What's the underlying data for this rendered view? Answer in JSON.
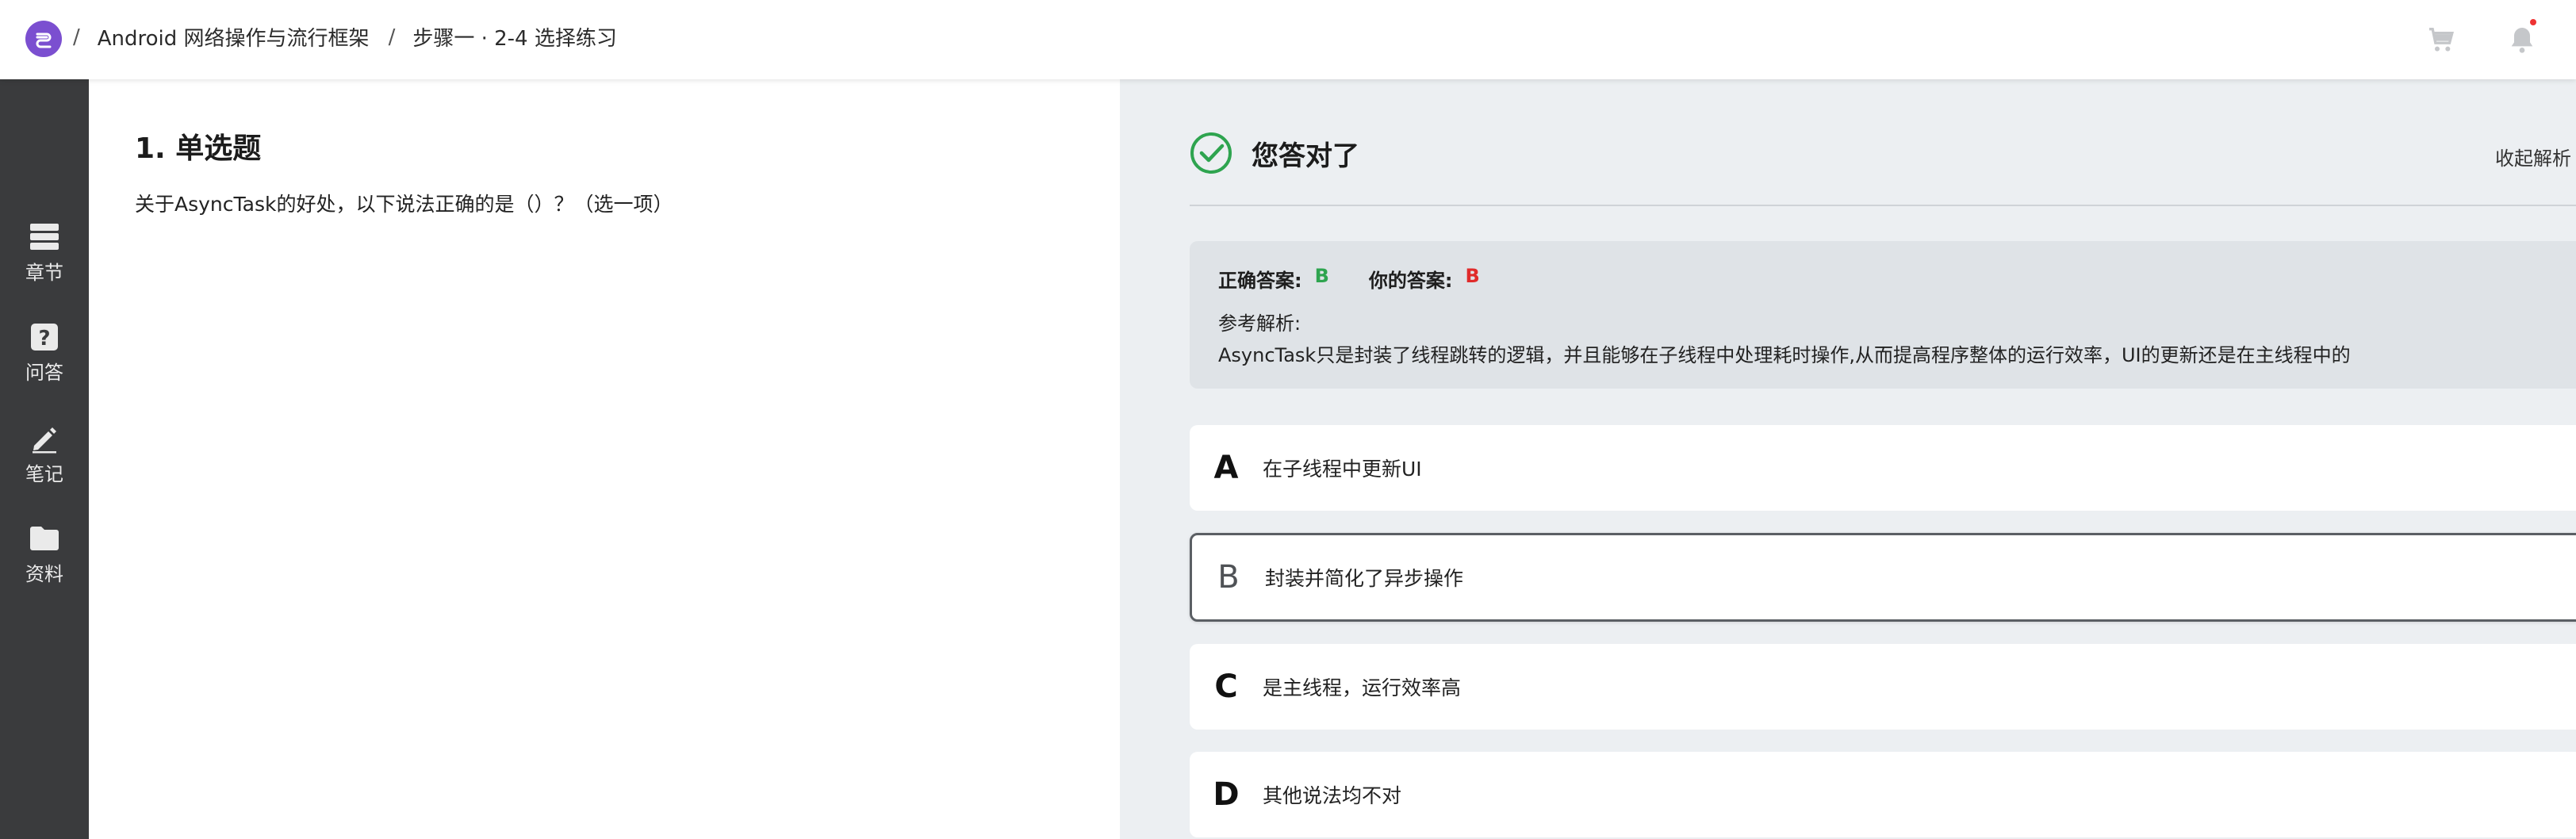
{
  "header": {
    "breadcrumbs": [
      "Android 网络操作与流行框架",
      "步骤一 · 2-4 选择练习"
    ],
    "separator": "/"
  },
  "sidebar": {
    "items": [
      {
        "label": "章节",
        "icon": "chapters-icon"
      },
      {
        "label": "问答",
        "icon": "question-icon"
      },
      {
        "label": "笔记",
        "icon": "edit-icon"
      },
      {
        "label": "资料",
        "icon": "folder-icon"
      }
    ]
  },
  "question": {
    "title": "1. 单选题",
    "text": "关于AsyncTask的好处，以下说法正确的是（）？（选一项）"
  },
  "result": {
    "status": "您答对了",
    "collapse": "收起解析",
    "correct_label": "正确答案:",
    "correct_value": "B",
    "yours_label": "你的答案:",
    "yours_value": "B",
    "analysis_label": "参考解析:",
    "analysis_text": "AsyncTask只是封装了线程跳转的逻辑，并且能够在子线程中处理耗时操作,从而提高程序整体的运行效率，UI的更新还是在主线程中的"
  },
  "options": [
    {
      "letter": "A",
      "text": "在子线程中更新UI"
    },
    {
      "letter": "B",
      "text": "封装并简化了异步操作"
    },
    {
      "letter": "C",
      "text": "是主线程，运行效率高"
    },
    {
      "letter": "D",
      "text": "其他说法均不对"
    }
  ],
  "colors": {
    "brand": "#7b4fd0",
    "correct_green": "#2ea44f",
    "answer_red": "#e02b2b",
    "sidebar_bg": "#3a3b3d"
  }
}
